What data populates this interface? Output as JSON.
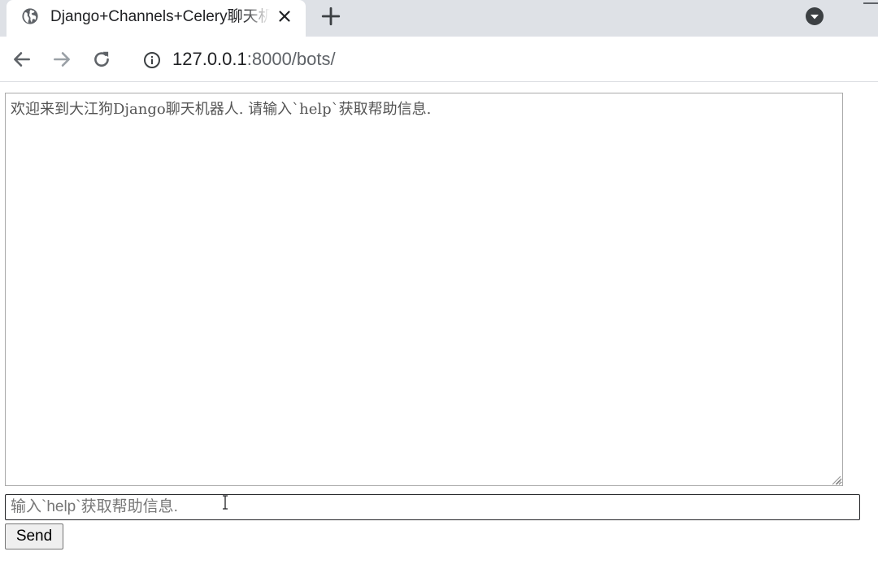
{
  "browser": {
    "tab": {
      "title": "Django+Channels+Celery聊天机器人",
      "favicon": "globe-icon",
      "close_icon": "close-icon"
    },
    "new_tab_icon": "plus-icon",
    "tab_search_icon": "chevron-down-circle-icon",
    "toolbar": {
      "back_icon": "arrow-left-icon",
      "forward_icon": "arrow-right-icon",
      "reload_icon": "reload-icon",
      "site_info_icon": "info-icon",
      "url_host": "127.0.0.1",
      "url_rest": ":8000/bots/"
    }
  },
  "chat": {
    "log_text": "欢迎来到大江狗Django聊天机器人. 请输入`help`获取帮助信息.",
    "input_placeholder": "输入`help`获取帮助信息.",
    "input_value": "",
    "send_label": "Send"
  },
  "colors": {
    "tabstrip_bg": "#dee1e6",
    "active_tab_bg": "#ffffff",
    "icon_gray": "#5f6368",
    "icon_disabled": "#9aa0a6",
    "textarea_border": "#a9a9a9",
    "input_border": "#202124",
    "button_bg": "#efefef"
  }
}
